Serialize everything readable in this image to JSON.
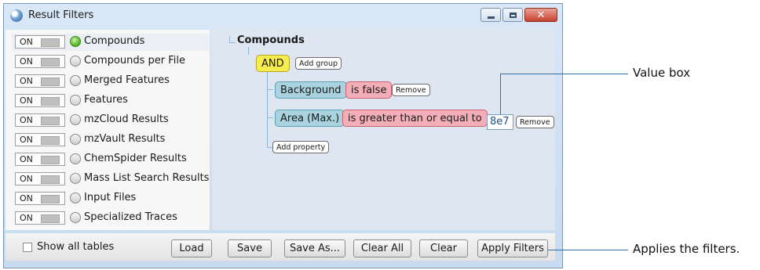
{
  "window": {
    "title": "Result Filters"
  },
  "tables": [
    {
      "toggle": "ON",
      "label": "Compounds",
      "active": true
    },
    {
      "toggle": "ON",
      "label": "Compounds per File",
      "active": false
    },
    {
      "toggle": "ON",
      "label": "Merged Features",
      "active": false
    },
    {
      "toggle": "ON",
      "label": "Features",
      "active": false
    },
    {
      "toggle": "ON",
      "label": "mzCloud Results",
      "active": false
    },
    {
      "toggle": "ON",
      "label": "mzVault Results",
      "active": false
    },
    {
      "toggle": "ON",
      "label": "ChemSpider Results",
      "active": false
    },
    {
      "toggle": "ON",
      "label": "Mass List Search Results",
      "active": false
    },
    {
      "toggle": "ON",
      "label": "Input Files",
      "active": false
    },
    {
      "toggle": "ON",
      "label": "Specialized Traces",
      "active": false
    }
  ],
  "tree": {
    "root": "Compounds",
    "logic": "AND",
    "add_group": "Add group",
    "conditions": [
      {
        "property": "Background",
        "operator": "is false",
        "value": "",
        "remove": "Remove"
      },
      {
        "property": "Area (Max.)",
        "operator": "is greater than or equal to",
        "value": "8e7",
        "remove": "Remove"
      }
    ],
    "add_property": "Add property"
  },
  "bottom": {
    "show_all_tables": "Show all tables",
    "buttons": {
      "load": "Load",
      "save": "Save",
      "save_as": "Save As...",
      "clear_all": "Clear All",
      "clear": "Clear",
      "apply": "Apply Filters"
    }
  },
  "callouts": {
    "value_box": "Value box",
    "apply": "Applies the filters."
  },
  "colors": {
    "and_chip": "#f7ec4d",
    "property_chip": "#a9d3de",
    "operator_chip": "#f3aeb7",
    "active_dot": "#4cb21f",
    "tree_bg": "#dee7f1",
    "callout_line": "#2f6fa8"
  }
}
